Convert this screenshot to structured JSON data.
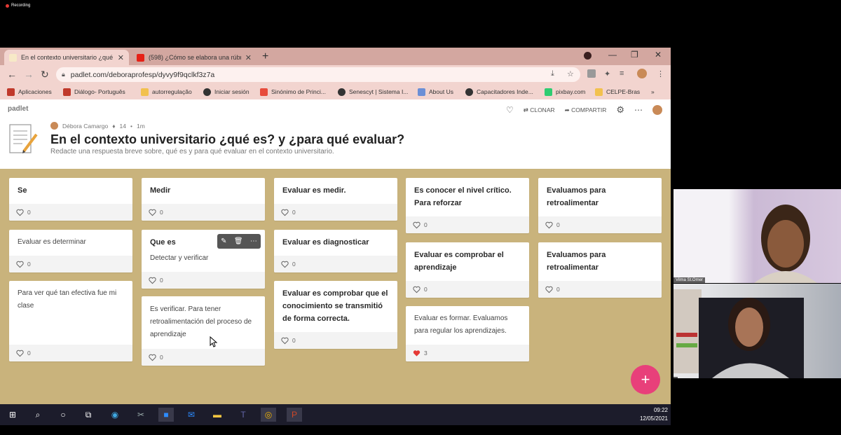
{
  "recording_label": "Recording",
  "browser": {
    "tabs": [
      {
        "label": "En el contexto universitario ¿qué",
        "active": true
      },
      {
        "label": "(598) ¿Cómo se elabora una rúbr",
        "active": false
      }
    ],
    "url": "padlet.com/deboraprofesp/dyvy9f9qclkf3z7a",
    "bookmarks": [
      "Aplicaciones",
      "Diálogo- Português",
      "autorregulação",
      "Iniciar sesión",
      "Sinónimo de Princi...",
      "Senescyt | Sistema I...",
      "About Us",
      "Capacitadores Inde...",
      "pixbay.com",
      "CELPE-Bras"
    ]
  },
  "padlet": {
    "brand": "padlet",
    "clone_label": "CLONAR",
    "share_label": "COMPARTIR",
    "author": "Débora Camargo",
    "likes": "14",
    "age": "1m",
    "title": "En el contexto universitario ¿qué es? y ¿para qué evaluar?",
    "subtitle": "Redacte una respuesta breve sobre, qué es y para qué evaluar en el contexto universitario.",
    "colors": {
      "wall": "#c9b37c",
      "fab": "#e8407a",
      "liked_heart": "#e53935"
    },
    "cards": [
      {
        "title": "Se",
        "body": "",
        "likes": "0",
        "liked": false
      },
      {
        "title": "",
        "body": "Evaluar es determinar",
        "likes": "0",
        "liked": false
      },
      {
        "title": "",
        "body": "Para ver qué tan efectiva fue mi clase",
        "likes": "0",
        "liked": false
      },
      {
        "title": "Medir",
        "body": "",
        "likes": "0",
        "liked": false
      },
      {
        "title": "Que es",
        "body": "Detectar y verificar",
        "likes": "0",
        "liked": false
      },
      {
        "title": "",
        "body": "Es verificar. Para tener retroalimentación del proceso de aprendizaje",
        "likes": "0",
        "liked": false
      },
      {
        "title": "Evaluar es medir.",
        "body": "",
        "likes": "0",
        "liked": false
      },
      {
        "title": "Evaluar es diagnosticar",
        "body": "",
        "likes": "0",
        "liked": false
      },
      {
        "title": "Evaluar es comprobar que el conocimiento se transmitió de forma correcta.",
        "body": "",
        "likes": "0",
        "liked": false
      },
      {
        "title": "Es conocer el nivel crítico. Para reforzar",
        "body": "",
        "likes": "0",
        "liked": false
      },
      {
        "title": "Evaluar es comprobar el aprendizaje",
        "body": "",
        "likes": "0",
        "liked": false
      },
      {
        "title": "",
        "body": "Evaluar es formar. Evaluamos para regular los aprendizajes.",
        "likes": "3",
        "liked": true
      },
      {
        "title": "Evaluamos para retroalimentar",
        "body": "",
        "likes": "0",
        "liked": false
      },
      {
        "title": "Evaluamos para retroalimentar",
        "body": "",
        "likes": "0",
        "liked": false
      }
    ]
  },
  "taskbar": {
    "time": "09:22",
    "date": "12/05/2021"
  },
  "participants": [
    {
      "name": "Vilma St.Omer"
    },
    {
      "name": ""
    }
  ]
}
